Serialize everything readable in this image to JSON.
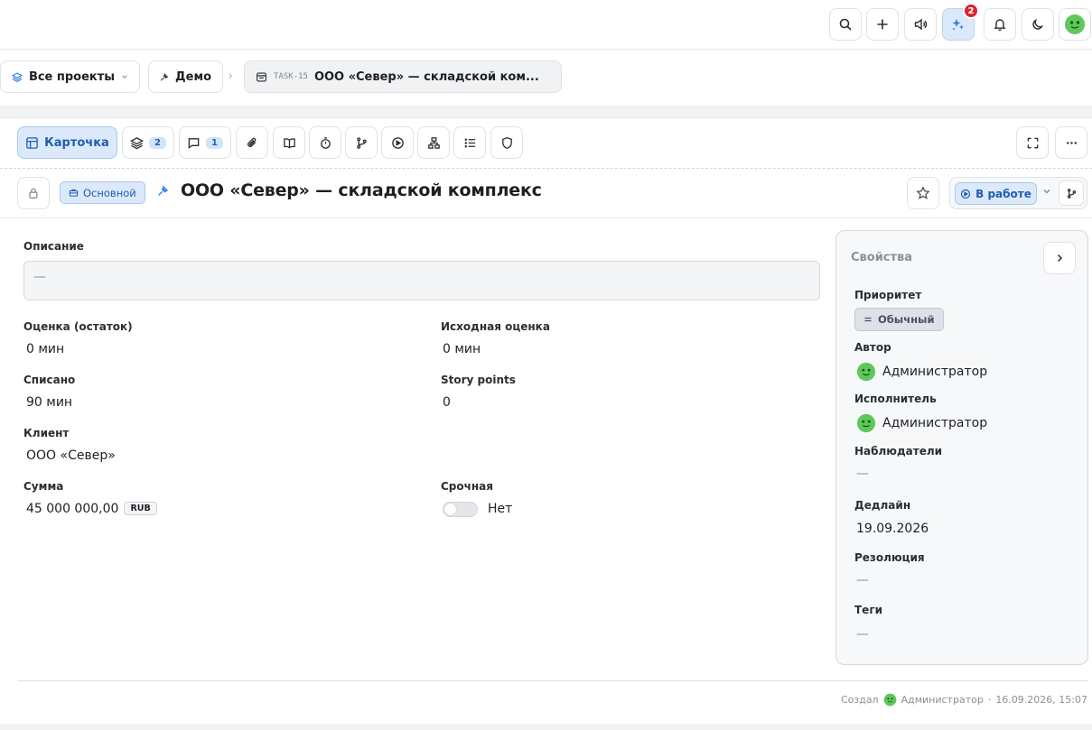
{
  "topbar": {
    "notification_count": "2",
    "icons": [
      "search-icon",
      "plus-icon",
      "megaphone-icon",
      "sparkles-icon",
      "bell-icon",
      "moon-icon",
      "avatar"
    ]
  },
  "breadcrumbs": {
    "all_projects": "Все проекты",
    "project": "Демо",
    "task_code": "TASK-15",
    "task_name": "ООО «Север» — складской ком..."
  },
  "tabs": {
    "card": "Карточка",
    "subtasks_count": "2",
    "comments_count": "1"
  },
  "task": {
    "type": "Основной",
    "title": "ООО «Север» — складской комплекс",
    "status": "В работе"
  },
  "fields": {
    "description_label": "Описание",
    "description_value": "—",
    "estimate_left_label": "Оценка (остаток)",
    "estimate_left_value": "0 мин",
    "original_estimate_label": "Исходная оценка",
    "original_estimate_value": "0 мин",
    "logged_label": "Списано",
    "logged_value": "90 мин",
    "story_points_label": "Story points",
    "story_points_value": "0",
    "client_label": "Клиент",
    "client_value": "ООО «Север»",
    "amount_label": "Сумма",
    "amount_value": "45 000 000,00",
    "currency": "RUB",
    "urgent_label": "Срочная",
    "urgent_value": "Нет"
  },
  "properties": {
    "title": "Свойства",
    "priority_label": "Приоритет",
    "priority_value": "Обычный",
    "author_label": "Автор",
    "author_value": "Администратор",
    "assignee_label": "Исполнитель",
    "assignee_value": "Администратор",
    "watchers_label": "Наблюдатели",
    "watchers_value": "—",
    "deadline_label": "Дедлайн",
    "deadline_value": "19.09.2026",
    "resolution_label": "Резолюция",
    "resolution_value": "—",
    "tags_label": "Теги",
    "tags_value": "—"
  },
  "footer": {
    "created_label": "Создал",
    "created_by": "Администратор",
    "separator": "·",
    "created_at": "16.09.2026, 15:07"
  },
  "colors": {
    "accent": "#1f5fae",
    "accent_bg": "#dbe9fb",
    "badge_red": "#d8252c",
    "avatar_green": "#5cc95a"
  }
}
